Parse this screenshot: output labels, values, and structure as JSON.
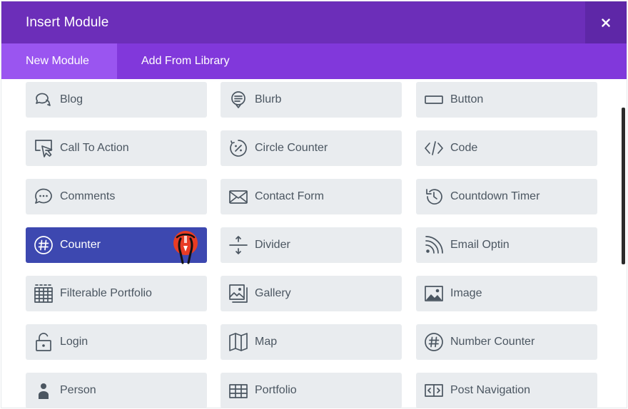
{
  "modal": {
    "title": "Insert Module",
    "close_label": "×"
  },
  "tabs": [
    {
      "label": "New Module",
      "active": true
    },
    {
      "label": "Add From Library",
      "active": false
    }
  ],
  "colors": {
    "header": "#6c2eb9",
    "tabbar": "#8138db",
    "active_tab": "#9a55f0",
    "module_bg": "#e9ecef",
    "module_active": "#3d48b0"
  },
  "modules": [
    {
      "label": "",
      "icon": "partial-row-icon"
    },
    {
      "label": "",
      "icon": "partial-row-icon"
    },
    {
      "label": "",
      "icon": "partial-row-icon"
    },
    {
      "label": "Blog",
      "icon": "chat-bubbles-icon"
    },
    {
      "label": "Blurb",
      "icon": "speech-bubble-icon"
    },
    {
      "label": "Button",
      "icon": "button-icon"
    },
    {
      "label": "Call To Action",
      "icon": "cursor-click-icon"
    },
    {
      "label": "Circle Counter",
      "icon": "circle-percent-icon"
    },
    {
      "label": "Code",
      "icon": "code-icon"
    },
    {
      "label": "Comments",
      "icon": "comment-dots-icon"
    },
    {
      "label": "Contact Form",
      "icon": "envelope-icon"
    },
    {
      "label": "Countdown Timer",
      "icon": "history-icon"
    },
    {
      "label": "Counter",
      "icon": "hash-circle-icon",
      "active": true
    },
    {
      "label": "Divider",
      "icon": "divider-icon"
    },
    {
      "label": "Email Optin",
      "icon": "rss-icon"
    },
    {
      "label": "Filterable Portfolio",
      "icon": "grid-table-icon"
    },
    {
      "label": "Gallery",
      "icon": "gallery-icon"
    },
    {
      "label": "Image",
      "icon": "image-icon"
    },
    {
      "label": "Login",
      "icon": "lock-icon"
    },
    {
      "label": "Map",
      "icon": "map-icon"
    },
    {
      "label": "Number Counter",
      "icon": "hash-circle-icon"
    },
    {
      "label": "Person",
      "icon": "person-icon"
    },
    {
      "label": "Portfolio",
      "icon": "portfolio-grid-icon"
    },
    {
      "label": "Post Navigation",
      "icon": "post-nav-icon"
    }
  ]
}
